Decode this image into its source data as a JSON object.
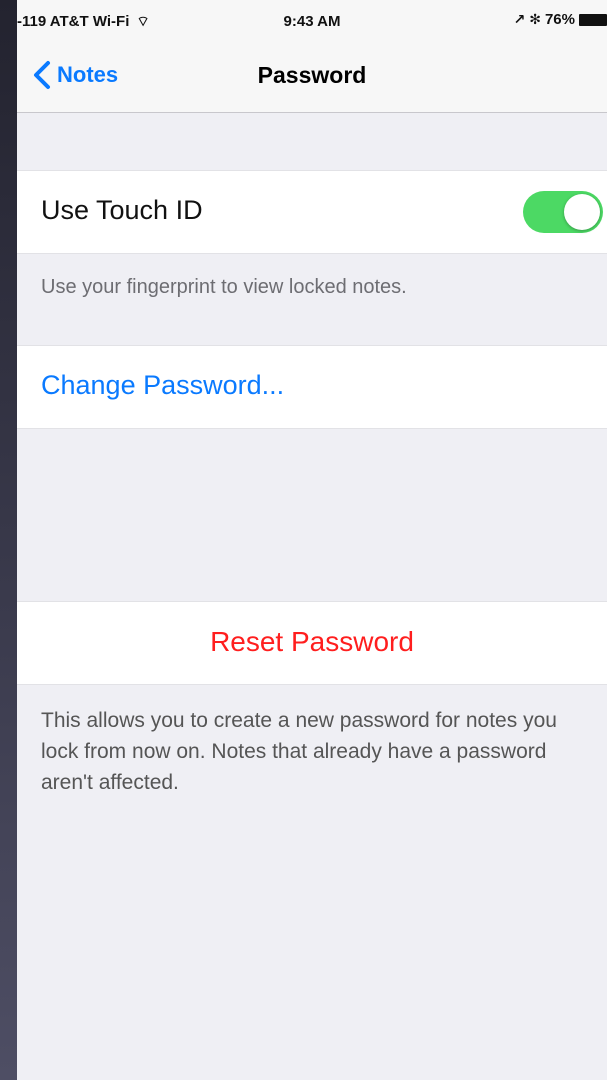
{
  "status_bar": {
    "carrier": "-119 AT&T Wi-Fi",
    "wifi_glyph": "⌔",
    "time": "9:43 AM",
    "right_glyphs": "↗ ✻",
    "battery_percent": "76%",
    "icons": [
      "wifi-icon",
      "location-icon",
      "bluetooth-icon",
      "battery-icon"
    ]
  },
  "nav": {
    "back_label": "Notes",
    "title": "Password"
  },
  "touch_id": {
    "label": "Use Touch ID",
    "enabled": true,
    "footer": "Use your fingerprint to view locked notes."
  },
  "change_password": {
    "label": "Change Password..."
  },
  "reset_password": {
    "label": "Reset Password",
    "footer": "This allows you to create a new password for notes you lock from now on. Notes that already have a password aren't affected."
  },
  "colors": {
    "tint": "#0a7aff",
    "destructive": "#ff1e1e",
    "toggle_on": "#4cd964",
    "background": "#efeff4"
  }
}
